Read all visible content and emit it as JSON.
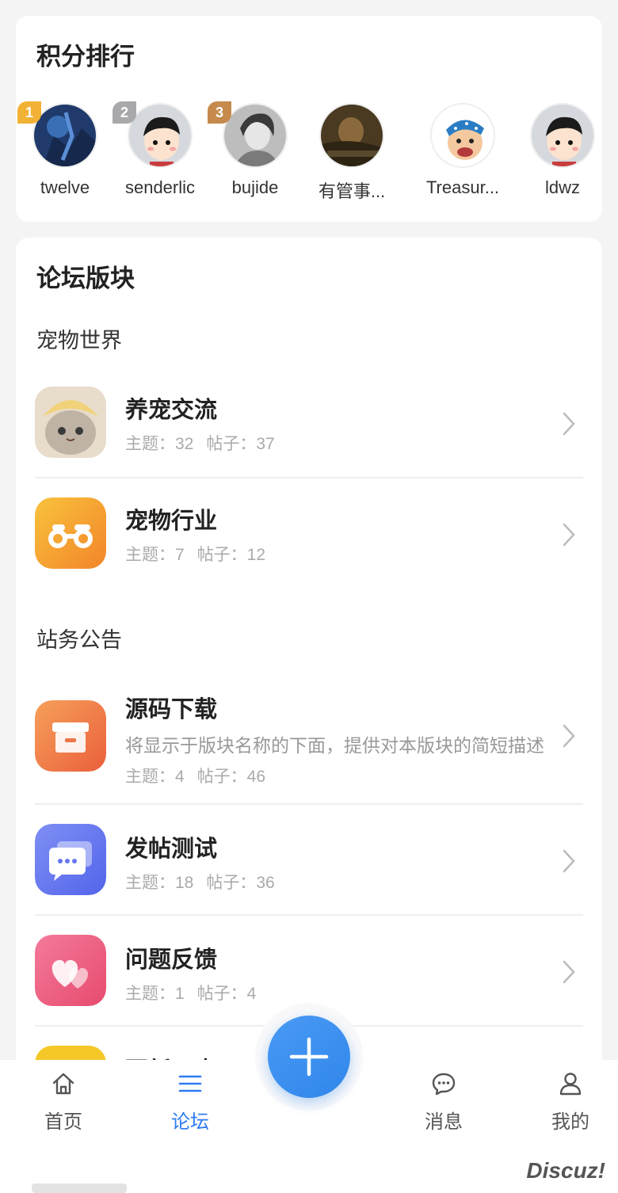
{
  "ranking": {
    "title": "积分排行",
    "users": [
      {
        "rank": "1",
        "name": "twelve",
        "badge_color": "#f2b235"
      },
      {
        "rank": "2",
        "name": "senderlic",
        "badge_color": "#a9a9ab"
      },
      {
        "rank": "3",
        "name": "bujide",
        "badge_color": "#c58a4c"
      },
      {
        "rank": "",
        "name": "有管事..."
      },
      {
        "rank": "",
        "name": "Treasur..."
      },
      {
        "rank": "",
        "name": "ldwz"
      }
    ]
  },
  "forums": {
    "title": "论坛版块",
    "sections": [
      {
        "title": "宠物世界",
        "items": [
          {
            "name": "养宠交流",
            "topics_label": "主题：32",
            "posts_label": "帖子：37"
          },
          {
            "name": "宠物行业",
            "topics_label": "主题：7",
            "posts_label": "帖子：12"
          }
        ]
      },
      {
        "title": "站务公告",
        "items": [
          {
            "name": "源码下载",
            "description": "将显示于版块名称的下面，提供对本版块的简短描述",
            "topics_label": "主题：4",
            "posts_label": "帖子：46"
          },
          {
            "name": "发帖测试",
            "topics_label": "主题：18",
            "posts_label": "帖子：36"
          },
          {
            "name": "问题反馈",
            "topics_label": "主题：1",
            "posts_label": "帖子：4"
          },
          {
            "name": "更新日志"
          }
        ]
      }
    ]
  },
  "tabbar": {
    "home": "首页",
    "forum": "论坛",
    "messages": "消息",
    "mine": "我的",
    "active_color": "#2f7bf0"
  },
  "watermark": "Discuz!"
}
